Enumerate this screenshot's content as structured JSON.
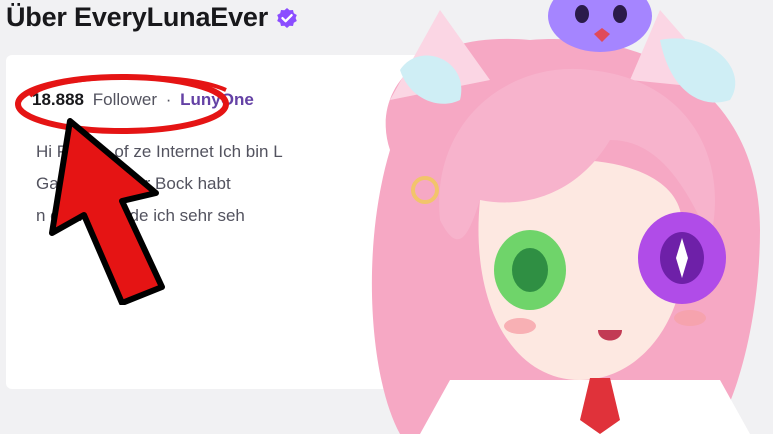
{
  "about": {
    "title": "Über EveryLunaEver",
    "follower_count": "18.888",
    "follower_label": "Follower",
    "separator": "·",
    "team_name": "LunyOne",
    "bio_lines": [
      "Hi People of ze Internet Ich bin L",
      "Ga    so wenn ihr Bock habt",
      "n      ch dazu rede ich sehr seh"
    ]
  },
  "colors": {
    "accent": "#6441a5",
    "highlight_red": "#e51414",
    "verified_badge": "#8b4dff"
  },
  "icons": {
    "verified": "verified-badge-icon"
  }
}
